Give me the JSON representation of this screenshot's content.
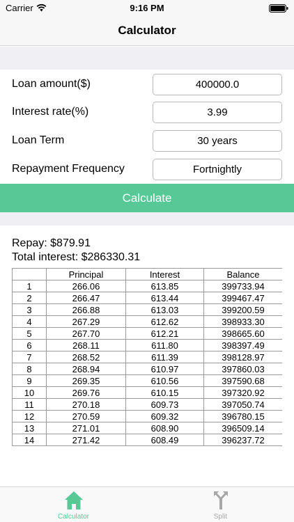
{
  "status": {
    "carrier": "Carrier",
    "time": "9:16 PM"
  },
  "nav": {
    "title": "Calculator"
  },
  "form": [
    {
      "label": "Loan amount($)",
      "value": "400000.0"
    },
    {
      "label": "Interest rate(%)",
      "value": "3.99"
    },
    {
      "label": "Loan Term",
      "value": "30 years"
    },
    {
      "label": "Repayment Frequency",
      "value": "Fortnightly"
    }
  ],
  "calculate_label": "Calculate",
  "results": {
    "repay": "Repay: $879.91",
    "total_interest": "Total interest: $286330.31"
  },
  "table": {
    "headers": [
      "",
      "Principal",
      "Interest",
      "Balance"
    ],
    "rows": [
      [
        "1",
        "266.06",
        "613.85",
        "399733.94"
      ],
      [
        "2",
        "266.47",
        "613.44",
        "399467.47"
      ],
      [
        "3",
        "266.88",
        "613.03",
        "399200.59"
      ],
      [
        "4",
        "267.29",
        "612.62",
        "398933.30"
      ],
      [
        "5",
        "267.70",
        "612.21",
        "398665.60"
      ],
      [
        "6",
        "268.11",
        "611.80",
        "398397.49"
      ],
      [
        "7",
        "268.52",
        "611.39",
        "398128.97"
      ],
      [
        "8",
        "268.94",
        "610.97",
        "397860.03"
      ],
      [
        "9",
        "269.35",
        "610.56",
        "397590.68"
      ],
      [
        "10",
        "269.76",
        "610.15",
        "397320.92"
      ],
      [
        "11",
        "270.18",
        "609.73",
        "397050.74"
      ],
      [
        "12",
        "270.59",
        "609.32",
        "396780.15"
      ],
      [
        "13",
        "271.01",
        "608.90",
        "396509.14"
      ],
      [
        "14",
        "271.42",
        "608.49",
        "396237.72"
      ]
    ]
  },
  "tabs": [
    {
      "label": "Calculator",
      "icon": "home-icon",
      "color": "#57c896"
    },
    {
      "label": "Split",
      "icon": "split-icon",
      "color": "#a8a8a8"
    }
  ],
  "colors": {
    "accent": "#57c896",
    "background_band": "#efeff4"
  }
}
